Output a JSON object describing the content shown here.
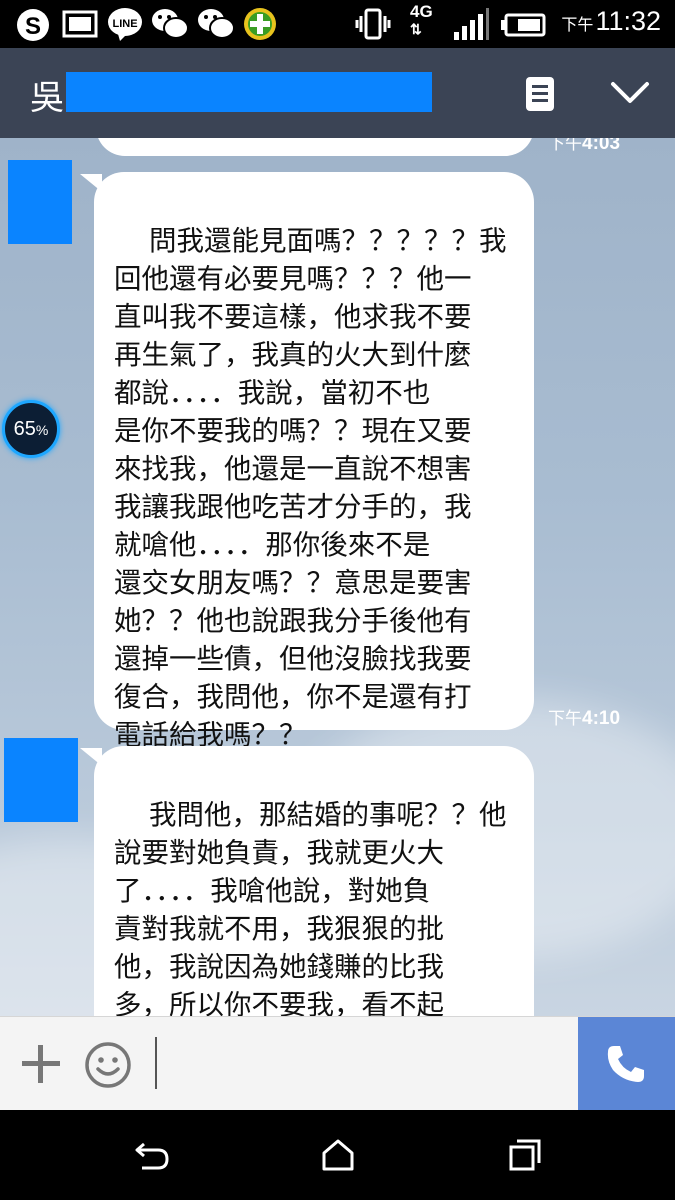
{
  "status_bar": {
    "time_prefix": "下午",
    "time": "11:32",
    "network": "4G"
  },
  "header": {
    "contact_name": "吳"
  },
  "messages": [
    {
      "text": "",
      "time_prefix": "下午",
      "time": "4:03"
    },
    {
      "text": "問我還能見面嗎？？？？？我\n回他還有必要見嗎？？？他一\n直叫我不要這樣，他求我不要\n再生氣了，我真的火大到什麼\n都說．．．．我說，當初不也\n是你不要我的嗎？？現在又要\n來找我，他還是一直說不想害\n我讓我跟他吃苦才分手的，我\n就嗆他．．．．那你後來不是\n還交女朋友嗎？？意思是要害\n她？？他也說跟我分手後他有\n還掉一些債，但他沒臉找我要\n復合，我問他，你不是還有打\n電話給我嗎？？",
      "time_prefix": "下午",
      "time": "4:10"
    },
    {
      "text": "我問他，那結婚的事呢？？他\n說要對她負責，我就更火大\n了．．．．我嗆他說，對她負\n責對我就不用，我狠狠的批\n他，我說因為她錢賺的比我\n多，所以你不要我，看不起\n我．他說不是．她沒有賺的我"
    }
  ],
  "battery_badge": {
    "value": "65",
    "unit": "%"
  }
}
